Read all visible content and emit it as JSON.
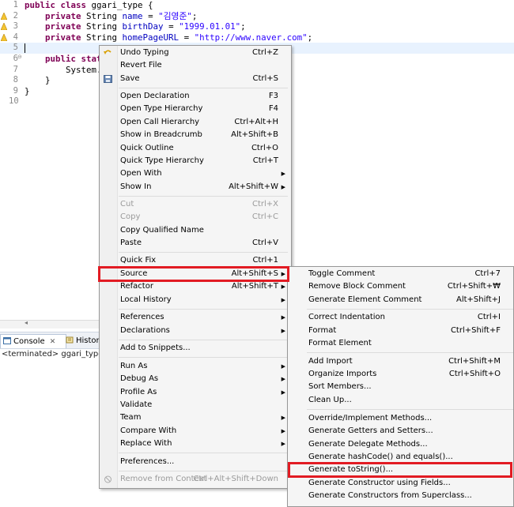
{
  "editor": {
    "lines": [
      {
        "num": "1",
        "kw1": "public class",
        "rest": " ggari_type {"
      },
      {
        "num": "2",
        "kw": "private",
        "type": " String ",
        "field": "name",
        "eq": " = ",
        "str": "\"김영준\"",
        "end": ";"
      },
      {
        "num": "3",
        "kw": "private",
        "type": " String ",
        "field": "birthDay",
        "eq": " = ",
        "str": "\"1999.01.01\"",
        "end": ";"
      },
      {
        "num": "4",
        "kw": "private",
        "type": " String ",
        "field": "homePageURL",
        "eq": " = ",
        "str": "\"http://www.naver.com\"",
        "end": ";"
      },
      {
        "num": "5"
      },
      {
        "num": "6",
        "kw": "public static",
        "rest": ""
      },
      {
        "num": "7",
        "rest": "System.o"
      },
      {
        "num": "8",
        "rest": "}"
      },
      {
        "num": "9",
        "rest": "}"
      },
      {
        "num": "10",
        "rest": ""
      }
    ]
  },
  "console": {
    "tabs": [
      {
        "label": "Console",
        "close": "✕"
      },
      {
        "label": "History"
      }
    ],
    "terminated": "<terminated> ggari_type [Java"
  },
  "main_menu": {
    "items": [
      {
        "label": "Undo Typing",
        "shortcut": "Ctrl+Z",
        "icon": "undo-icon"
      },
      {
        "label": "Revert File",
        "shortcut": ""
      },
      {
        "label": "Save",
        "shortcut": "Ctrl+S",
        "icon": "save-icon"
      },
      {
        "label": "Open Declaration",
        "shortcut": "F3"
      },
      {
        "label": "Open Type Hierarchy",
        "shortcut": "F4"
      },
      {
        "label": "Open Call Hierarchy",
        "shortcut": "Ctrl+Alt+H"
      },
      {
        "label": "Show in Breadcrumb",
        "shortcut": "Alt+Shift+B"
      },
      {
        "label": "Quick Outline",
        "shortcut": "Ctrl+O"
      },
      {
        "label": "Quick Type Hierarchy",
        "shortcut": "Ctrl+T"
      },
      {
        "label": "Open With",
        "shortcut": ""
      },
      {
        "label": "Show In",
        "shortcut": "Alt+Shift+W"
      },
      {
        "label": "Cut",
        "shortcut": "Ctrl+X"
      },
      {
        "label": "Copy",
        "shortcut": "Ctrl+C"
      },
      {
        "label": "Copy Qualified Name",
        "shortcut": ""
      },
      {
        "label": "Paste",
        "shortcut": "Ctrl+V"
      },
      {
        "label": "Quick Fix",
        "shortcut": "Ctrl+1"
      },
      {
        "label": "Source",
        "shortcut": "Alt+Shift+S"
      },
      {
        "label": "Refactor",
        "shortcut": "Alt+Shift+T"
      },
      {
        "label": "Local History",
        "shortcut": ""
      },
      {
        "label": "References",
        "shortcut": ""
      },
      {
        "label": "Declarations",
        "shortcut": ""
      },
      {
        "label": "Add to Snippets...",
        "shortcut": ""
      },
      {
        "label": "Run As",
        "shortcut": ""
      },
      {
        "label": "Debug As",
        "shortcut": ""
      },
      {
        "label": "Profile As",
        "shortcut": ""
      },
      {
        "label": "Validate",
        "shortcut": ""
      },
      {
        "label": "Team",
        "shortcut": ""
      },
      {
        "label": "Compare With",
        "shortcut": ""
      },
      {
        "label": "Replace With",
        "shortcut": ""
      },
      {
        "label": "Preferences...",
        "shortcut": ""
      },
      {
        "label": "Remove from Context",
        "shortcut": "Ctrl+Alt+Shift+Down",
        "icon": "remove-context-icon"
      }
    ],
    "arrow": "▶"
  },
  "source_menu": {
    "items": [
      {
        "label": "Toggle Comment",
        "shortcut": "Ctrl+7"
      },
      {
        "label": "Remove Block Comment",
        "shortcut": "Ctrl+Shift+₩"
      },
      {
        "label": "Generate Element Comment",
        "shortcut": "Alt+Shift+J"
      },
      {
        "label": "Correct Indentation",
        "shortcut": "Ctrl+I"
      },
      {
        "label": "Format",
        "shortcut": "Ctrl+Shift+F"
      },
      {
        "label": "Format Element",
        "shortcut": ""
      },
      {
        "label": "Add Import",
        "shortcut": "Ctrl+Shift+M"
      },
      {
        "label": "Organize Imports",
        "shortcut": "Ctrl+Shift+O"
      },
      {
        "label": "Sort Members...",
        "shortcut": ""
      },
      {
        "label": "Clean Up...",
        "shortcut": ""
      },
      {
        "label": "Override/Implement Methods...",
        "shortcut": ""
      },
      {
        "label": "Generate Getters and Setters...",
        "shortcut": ""
      },
      {
        "label": "Generate Delegate Methods...",
        "shortcut": ""
      },
      {
        "label": "Generate hashCode() and equals()...",
        "shortcut": ""
      },
      {
        "label": "Generate toString()...",
        "shortcut": ""
      },
      {
        "label": "Generate Constructor using Fields...",
        "shortcut": ""
      },
      {
        "label": "Generate Constructors from Superclass...",
        "shortcut": ""
      }
    ]
  },
  "colors": {
    "highlight_box": "#e21b23",
    "keyword": "#7f0055",
    "field": "#0000c0",
    "string": "#2a00ff"
  }
}
